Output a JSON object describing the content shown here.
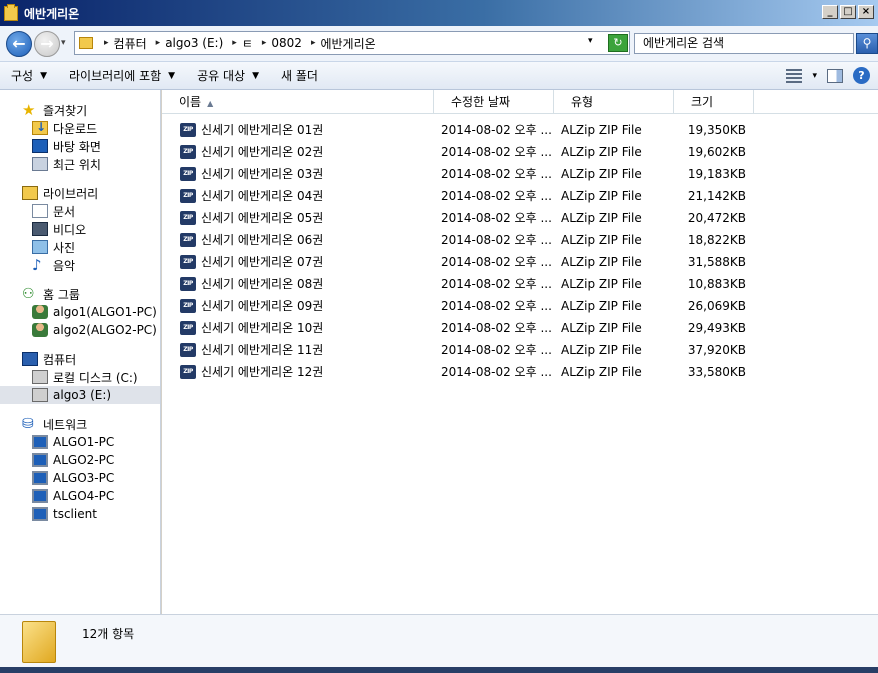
{
  "window": {
    "title": "에반게리온",
    "btn_min": "_",
    "btn_max": "□",
    "btn_close": "×"
  },
  "address": {
    "back_glyph": "←",
    "fwd_glyph": "→",
    "crumbs": [
      "컴퓨터",
      "algo3 (E:)",
      "ㅌ",
      "0802",
      "에반게리온"
    ],
    "crumb_sep": "▸",
    "refresh_glyph": "↻",
    "search_placeholder": "에반게리온 검색",
    "search_glyph": "⚲"
  },
  "toolbar": {
    "items": [
      {
        "label": "구성",
        "dropdown": true
      },
      {
        "label": "라이브러리에 포함",
        "dropdown": true
      },
      {
        "label": "공유 대상",
        "dropdown": true
      },
      {
        "label": "새 폴더",
        "dropdown": false
      }
    ],
    "help_glyph": "?"
  },
  "nav": {
    "groups": [
      {
        "label": "즐겨찾기",
        "icon": "favorites-star-icon",
        "items": [
          {
            "label": "다운로드",
            "icon": "downloads-icon"
          },
          {
            "label": "바탕 화면",
            "icon": "desktop-icon"
          },
          {
            "label": "최근 위치",
            "icon": "recent-places-icon"
          }
        ]
      },
      {
        "label": "라이브러리",
        "icon": "libraries-icon",
        "items": [
          {
            "label": "문서",
            "icon": "documents-icon"
          },
          {
            "label": "비디오",
            "icon": "videos-icon"
          },
          {
            "label": "사진",
            "icon": "pictures-icon"
          },
          {
            "label": "음악",
            "icon": "music-icon"
          }
        ]
      },
      {
        "label": "홈 그룹",
        "icon": "homegroup-icon",
        "items": [
          {
            "label": "algo1(ALGO1-PC)",
            "icon": "user-icon"
          },
          {
            "label": "algo2(ALGO2-PC)",
            "icon": "user-icon"
          }
        ]
      },
      {
        "label": "컴퓨터",
        "icon": "computer-icon",
        "items": [
          {
            "label": "로컬 디스크 (C:)",
            "icon": "local-disk-icon"
          },
          {
            "label": "algo3 (E:)",
            "icon": "drive-icon",
            "selected": true
          }
        ]
      },
      {
        "label": "네트워크",
        "icon": "network-icon",
        "items": [
          {
            "label": "ALGO1-PC",
            "icon": "network-pc-icon"
          },
          {
            "label": "ALGO2-PC",
            "icon": "network-pc-icon"
          },
          {
            "label": "ALGO3-PC",
            "icon": "network-pc-icon"
          },
          {
            "label": "ALGO4-PC",
            "icon": "network-pc-icon"
          },
          {
            "label": "tsclient",
            "icon": "network-pc-icon"
          }
        ]
      }
    ]
  },
  "columns": {
    "name": "이름",
    "modified": "수정한 날짜",
    "type": "유형",
    "size": "크기",
    "sort_glyph": "▲"
  },
  "files": [
    {
      "name": "신세기 에반게리온 01권",
      "modified": "2014-08-02 오후 ...",
      "type": "ALZip ZIP File",
      "size": "19,350KB"
    },
    {
      "name": "신세기 에반게리온 02권",
      "modified": "2014-08-02 오후 ...",
      "type": "ALZip ZIP File",
      "size": "19,602KB"
    },
    {
      "name": "신세기 에반게리온 03권",
      "modified": "2014-08-02 오후 ...",
      "type": "ALZip ZIP File",
      "size": "19,183KB"
    },
    {
      "name": "신세기 에반게리온 04권",
      "modified": "2014-08-02 오후 ...",
      "type": "ALZip ZIP File",
      "size": "21,142KB"
    },
    {
      "name": "신세기 에반게리온 05권",
      "modified": "2014-08-02 오후 ...",
      "type": "ALZip ZIP File",
      "size": "20,472KB"
    },
    {
      "name": "신세기 에반게리온 06권",
      "modified": "2014-08-02 오후 ...",
      "type": "ALZip ZIP File",
      "size": "18,822KB"
    },
    {
      "name": "신세기 에반게리온 07권",
      "modified": "2014-08-02 오후 ...",
      "type": "ALZip ZIP File",
      "size": "31,588KB"
    },
    {
      "name": "신세기 에반게리온 08권",
      "modified": "2014-08-02 오후 ...",
      "type": "ALZip ZIP File",
      "size": "10,883KB"
    },
    {
      "name": "신세기 에반게리온 09권",
      "modified": "2014-08-02 오후 ...",
      "type": "ALZip ZIP File",
      "size": "26,069KB"
    },
    {
      "name": "신세기 에반게리온 10권",
      "modified": "2014-08-02 오후 ...",
      "type": "ALZip ZIP File",
      "size": "29,493KB"
    },
    {
      "name": "신세기 에반게리온 11권",
      "modified": "2014-08-02 오후 ...",
      "type": "ALZip ZIP File",
      "size": "37,920KB"
    },
    {
      "name": "신세기 에반게리온 12권",
      "modified": "2014-08-02 오후 ...",
      "type": "ALZip ZIP File",
      "size": "33,580KB"
    }
  ],
  "zip_icon_text": "ZIP",
  "details": {
    "item_count": "12개 항목"
  }
}
